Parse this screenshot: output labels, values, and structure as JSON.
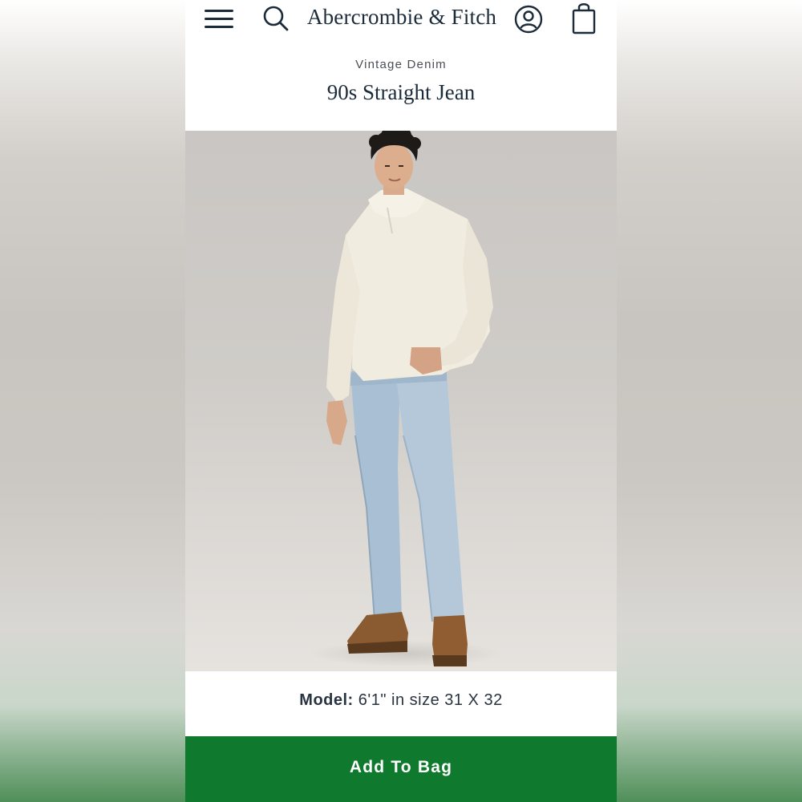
{
  "header": {
    "brand": "Abercrombie & Fitch",
    "icons": [
      "menu-icon",
      "search-icon",
      "account-icon",
      "shopping-bag-icon"
    ]
  },
  "product": {
    "category": "Vintage Denim",
    "title": "90s Straight Jean",
    "image_description": "Model wearing cream half-zip sweatshirt, light wash straight jeans and brown boots",
    "model_label": "Model:",
    "model_details": "6'1\" in size 31 X 32"
  },
  "actions": {
    "add_to_bag_label": "Add To Bag"
  },
  "colors": {
    "brand_text": "#1c2b3a",
    "cta_green": "#0f7a2e",
    "photo_background": "#cbc8c4"
  }
}
